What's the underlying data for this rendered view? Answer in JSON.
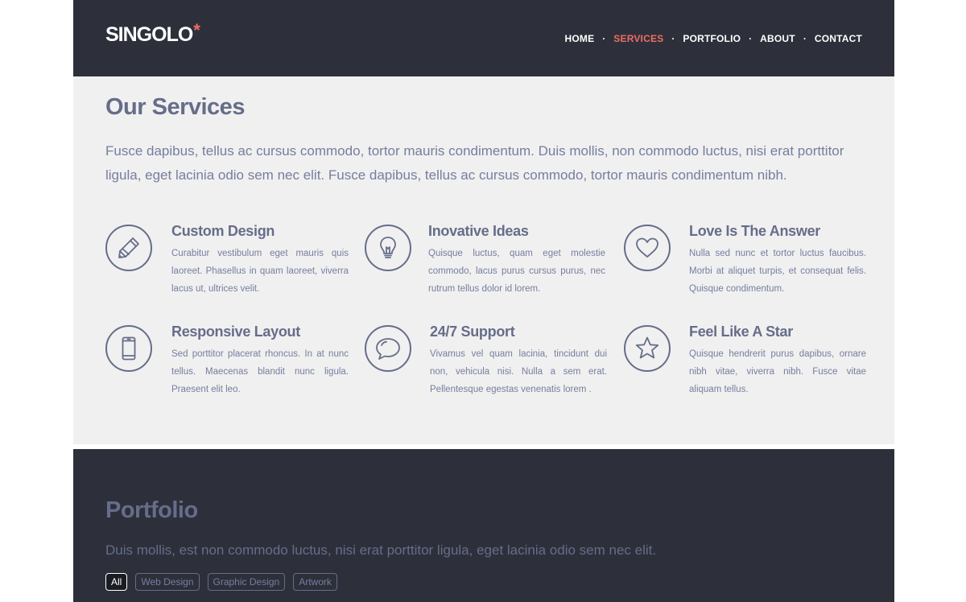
{
  "header": {
    "logo": "SINGOLO",
    "logo_mark": "*",
    "nav": [
      {
        "label": "HOME",
        "active": false
      },
      {
        "label": "SERVICES",
        "active": true
      },
      {
        "label": "PORTFOLIO",
        "active": false
      },
      {
        "label": "ABOUT",
        "active": false
      },
      {
        "label": "CONTACT",
        "active": false
      }
    ],
    "separator": "·"
  },
  "services": {
    "title": "Our Services",
    "description": "Fusce dapibus, tellus ac cursus commodo, tortor mauris condimentum. Duis mollis, non commodo luctus, nisi erat porttitor ligula, eget lacinia odio sem nec elit. Fusce dapibus, tellus ac cursus commodo, tortor mauris condimentum nibh.",
    "items": [
      {
        "icon": "pencil-icon",
        "title": "Custom Design",
        "text": "Curabitur vestibulum eget mauris quis laoreet. Phasellus in quam laoreet, viverra lacus ut, ultrices velit."
      },
      {
        "icon": "lightbulb-icon",
        "title": "Inovative Ideas",
        "text": "Quisque luctus, quam eget molestie commodo, lacus purus cursus purus, nec rutrum tellus dolor id lorem."
      },
      {
        "icon": "heart-icon",
        "title": "Love Is The Answer",
        "text": "Nulla sed nunc et tortor luctus faucibus. Morbi at aliquet turpis, et consequat felis. Quisque condimentum."
      },
      {
        "icon": "smartphone-icon",
        "title": "Responsive Layout",
        "text": "Sed porttitor placerat rhoncus. In at nunc tellus. Maecenas blandit nunc ligula. Praesent elit leo."
      },
      {
        "icon": "chat-bubble-icon",
        "title": "24/7 Support",
        "text": "Vivamus vel quam lacinia, tincidunt dui non, vehicula nisi. Nulla a sem erat. Pellentesque egestas venenatis lorem ."
      },
      {
        "icon": "star-icon",
        "title": "Feel Like A Star",
        "text": "Quisque hendrerit purus dapibus, ornare nibh vitae, viverra nibh. Fusce vitae aliquam tellus."
      }
    ]
  },
  "portfolio": {
    "title": "Portfolio",
    "description": "Duis mollis, est non commodo luctus, nisi erat porttitor ligula, eget lacinia odio sem nec elit.",
    "filters": [
      {
        "label": "All",
        "active": true
      },
      {
        "label": "Web Design",
        "active": false
      },
      {
        "label": "Graphic Design",
        "active": false
      },
      {
        "label": "Artwork",
        "active": false
      }
    ]
  },
  "colors": {
    "dark_bg": "#2d303a",
    "accent": "#f06c64",
    "light_bg": "#f0f0f0",
    "heading": "#666d89",
    "text": "#767e9e"
  }
}
